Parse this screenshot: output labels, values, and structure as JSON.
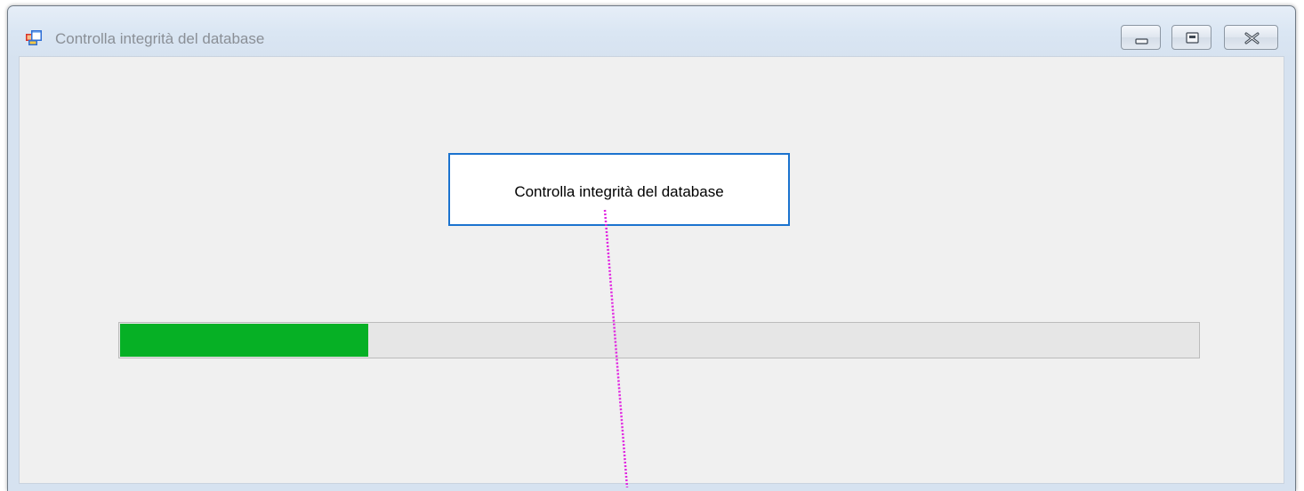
{
  "window": {
    "title": "Controlla integrità del database",
    "icon": "app-form-icon",
    "buttons": {
      "minimize": "minimize-icon",
      "maximize": "restore-icon",
      "close": "close-icon"
    }
  },
  "main": {
    "label_text": "Controlla integrità del database",
    "progress": {
      "value_fraction": 0.23,
      "fill_color": "#06b025",
      "track_color": "#e6e6e6"
    }
  },
  "colors": {
    "label_border": "#1b73cf",
    "connector": "#e020e0"
  }
}
